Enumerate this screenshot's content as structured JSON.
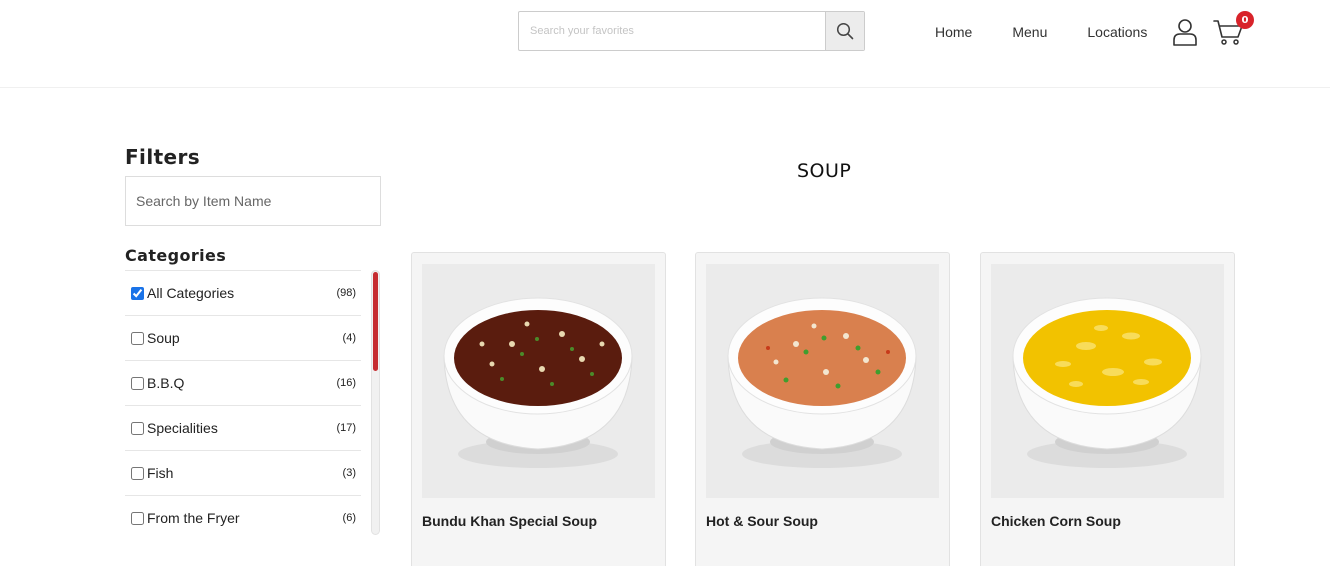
{
  "header": {
    "search_placeholder": "Search your favorites",
    "nav": [
      "Home",
      "Menu",
      "Locations"
    ],
    "cart_count": "0"
  },
  "sidebar": {
    "title": "Filters",
    "search_placeholder": "Search by Item Name",
    "categories_title": "Categories",
    "categories": [
      {
        "label": "All Categories",
        "count": "(98)",
        "checked": true
      },
      {
        "label": "Soup",
        "count": "(4)",
        "checked": false
      },
      {
        "label": "B.B.Q",
        "count": "(16)",
        "checked": false
      },
      {
        "label": "Specialities",
        "count": "(17)",
        "checked": false
      },
      {
        "label": "Fish",
        "count": "(3)",
        "checked": false
      },
      {
        "label": "From the Fryer",
        "count": "(6)",
        "checked": false
      }
    ]
  },
  "main": {
    "section_title": "SOUP",
    "products": [
      {
        "name": "Bundu Khan Special Soup",
        "soup_color": "#5a1c0e"
      },
      {
        "name": "Hot & Sour Soup",
        "soup_color": "#d9804e"
      },
      {
        "name": "Chicken Corn Soup",
        "soup_color": "#f2c200"
      }
    ]
  },
  "colors": {
    "accent_red": "#d8232a",
    "scroll_thumb": "#c62d31"
  }
}
